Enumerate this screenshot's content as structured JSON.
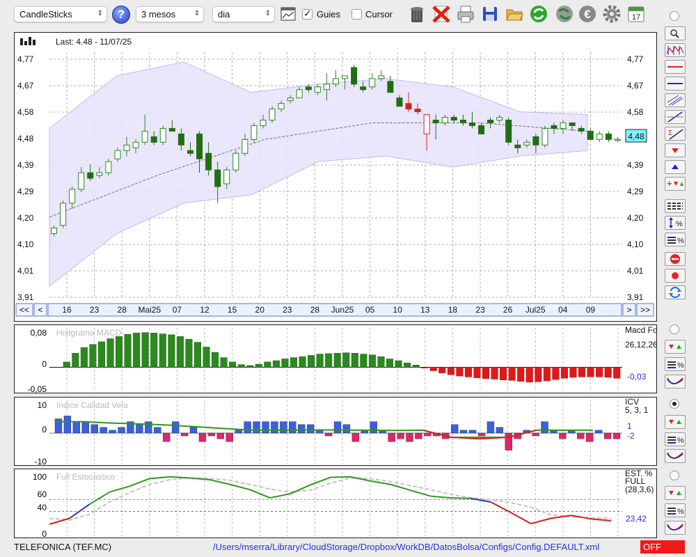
{
  "toolbar": {
    "chart_type": "CandleSticks",
    "period": "3 mesos",
    "interval": "dia",
    "guides_label": "Guies",
    "guides_checked": true,
    "cursor_label": "Cursor",
    "cursor_checked": false,
    "icons": [
      "help-icon",
      "chart-window-icon",
      "trash-icon",
      "delete-icon",
      "printer-icon",
      "save-icon",
      "open-folder-icon",
      "refresh-icon",
      "globe-refresh-icon",
      "euro-icon",
      "gear-icon",
      "calendar-icon"
    ],
    "calendar_day": "17"
  },
  "main_chart": {
    "last_label": "Last: 4.48 - 11/07/25",
    "current_value": "4,48",
    "y_ticks": [
      "4,77",
      "4,67",
      "4,58",
      "4,48",
      "4,39",
      "4,29",
      "4,20",
      "4,10",
      "4,01",
      "3,91"
    ],
    "x_labels": [
      "16",
      "23",
      "28",
      "Mai25",
      "07",
      "12",
      "15",
      "20",
      "23",
      "28",
      "Jun25",
      "05",
      "10",
      "13",
      "18",
      "23",
      "26",
      "Jul25",
      "04",
      "09"
    ],
    "nav_first": "<<",
    "nav_prev": "<",
    "nav_next": ">",
    "nav_last": ">>"
  },
  "macd_panel": {
    "title": "Histgrama MACD",
    "legend_name": "Macd Forest",
    "legend_params": "26,12,26",
    "value": "-0,03",
    "y_ticks": [
      "0,08",
      "0",
      "-0,05"
    ]
  },
  "icv_panel": {
    "title": "Indice Calidad Vela",
    "legend_name": "ICV",
    "legend_params": "5, 3, 1",
    "value_a": "1",
    "value_b": "-2",
    "y_ticks": [
      "10",
      "0",
      "-10"
    ]
  },
  "stoch_panel": {
    "title": "Full Estocastico",
    "legend_name": "EST. % FULL",
    "legend_params": "(28,3,6)",
    "value": "23,42",
    "y_ticks": [
      "100",
      "60",
      "40",
      "0"
    ]
  },
  "status": {
    "ticker": "TELEFONICA (TEF.MC)",
    "config_path": "/Users/mserra/Library/CloudStorage/Dropbox/WorkDB/DatosBolsa/Configs/Config.DEFAULT.xml",
    "state": "OFF"
  },
  "colors": {
    "up": "#2b8a1e",
    "down": "#1f6e12",
    "neg": "#e02020",
    "blue": "#3a5fe0",
    "pink": "#e0256a",
    "band_fill": "#e7e2fb",
    "band_line": "#b9b0ee"
  },
  "chart_data": [
    {
      "type": "candlestick",
      "title": "Last: 4.48 - 11/07/25",
      "ylim": [
        3.91,
        4.77
      ],
      "x_axis_labels": [
        "16",
        "23",
        "28",
        "Mai25",
        "07",
        "12",
        "15",
        "20",
        "23",
        "28",
        "Jun25",
        "05",
        "10",
        "13",
        "18",
        "23",
        "26",
        "Jul25",
        "04",
        "09"
      ],
      "ohlc": [
        [
          4.14,
          4.17,
          4.13,
          4.16
        ],
        [
          4.17,
          4.26,
          4.16,
          4.25
        ],
        [
          4.25,
          4.31,
          4.23,
          4.3
        ],
        [
          4.3,
          4.38,
          4.29,
          4.36
        ],
        [
          4.36,
          4.39,
          4.33,
          4.34
        ],
        [
          4.35,
          4.38,
          4.34,
          4.36
        ],
        [
          4.36,
          4.41,
          4.35,
          4.4
        ],
        [
          4.41,
          4.45,
          4.4,
          4.44
        ],
        [
          4.44,
          4.49,
          4.42,
          4.46
        ],
        [
          4.45,
          4.48,
          4.43,
          4.47
        ],
        [
          4.47,
          4.57,
          4.46,
          4.51
        ],
        [
          4.49,
          4.51,
          4.46,
          4.47
        ],
        [
          4.47,
          4.53,
          4.46,
          4.52
        ],
        [
          4.52,
          4.55,
          4.51,
          4.51
        ],
        [
          4.5,
          4.52,
          4.44,
          4.46
        ],
        [
          4.44,
          4.47,
          4.42,
          4.43
        ],
        [
          4.5,
          4.51,
          4.36,
          4.41
        ],
        [
          4.43,
          4.47,
          4.35,
          4.37
        ],
        [
          4.37,
          4.4,
          4.25,
          4.31
        ],
        [
          4.32,
          4.38,
          4.3,
          4.37
        ],
        [
          4.37,
          4.44,
          4.36,
          4.43
        ],
        [
          4.43,
          4.5,
          4.42,
          4.48
        ],
        [
          4.48,
          4.54,
          4.47,
          4.53
        ],
        [
          4.53,
          4.57,
          4.52,
          4.55
        ],
        [
          4.55,
          4.6,
          4.54,
          4.59
        ],
        [
          4.59,
          4.62,
          4.58,
          4.61
        ],
        [
          4.62,
          4.64,
          4.61,
          4.63
        ],
        [
          4.63,
          4.67,
          4.63,
          4.66
        ],
        [
          4.67,
          4.68,
          4.65,
          4.66
        ],
        [
          4.65,
          4.68,
          4.64,
          4.67
        ],
        [
          4.66,
          4.72,
          4.62,
          4.68
        ],
        [
          4.68,
          4.73,
          4.67,
          4.7
        ],
        [
          4.7,
          4.71,
          4.66,
          4.71
        ],
        [
          4.74,
          4.75,
          4.67,
          4.68
        ],
        [
          4.67,
          4.69,
          4.65,
          4.66
        ],
        [
          4.67,
          4.72,
          4.66,
          4.7
        ],
        [
          4.7,
          4.73,
          4.69,
          4.71
        ],
        [
          4.69,
          4.71,
          4.66,
          4.65
        ],
        [
          4.63,
          4.64,
          4.61,
          4.6
        ],
        [
          4.61,
          4.65,
          4.58,
          4.59
        ],
        [
          4.59,
          4.61,
          4.57,
          4.58
        ],
        [
          4.5,
          4.57,
          4.44,
          4.57
        ],
        [
          4.55,
          4.57,
          4.48,
          4.54
        ],
        [
          4.54,
          4.57,
          4.53,
          4.56
        ],
        [
          4.56,
          4.57,
          4.54,
          4.55
        ],
        [
          4.55,
          4.57,
          4.53,
          4.54
        ],
        [
          4.54,
          4.58,
          4.52,
          4.53
        ],
        [
          4.53,
          4.54,
          4.5,
          4.5
        ],
        [
          4.55,
          4.56,
          4.52,
          4.54
        ],
        [
          4.55,
          4.57,
          4.54,
          4.56
        ],
        [
          4.55,
          4.56,
          4.46,
          4.47
        ],
        [
          4.46,
          4.48,
          4.43,
          4.45
        ],
        [
          4.46,
          4.48,
          4.45,
          4.47
        ],
        [
          4.49,
          4.5,
          4.43,
          4.46
        ],
        [
          4.46,
          4.53,
          4.45,
          4.52
        ],
        [
          4.53,
          4.54,
          4.5,
          4.52
        ],
        [
          4.52,
          4.55,
          4.5,
          4.54
        ],
        [
          4.54,
          4.54,
          4.51,
          4.53
        ],
        [
          4.52,
          4.53,
          4.5,
          4.51
        ],
        [
          4.51,
          4.52,
          4.48,
          4.48
        ],
        [
          4.48,
          4.51,
          4.47,
          4.5
        ],
        [
          4.5,
          4.51,
          4.47,
          4.48
        ],
        [
          4.48,
          4.49,
          4.47,
          4.48
        ]
      ],
      "ma_values": [
        4.2,
        4.35,
        4.48,
        4.54,
        4.54,
        4.51
      ],
      "band_upper": [
        4.52,
        4.71,
        4.76,
        4.65,
        4.68,
        4.7,
        4.67,
        4.58,
        4.57
      ],
      "band_lower": [
        3.95,
        4.14,
        4.25,
        4.28,
        4.4,
        4.42,
        4.38,
        4.42,
        4.44
      ]
    },
    {
      "type": "bar",
      "title": "Histgrama MACD",
      "ylim": [
        -0.05,
        0.08
      ],
      "values": [
        0.012,
        0.032,
        0.045,
        0.052,
        0.058,
        0.065,
        0.07,
        0.075,
        0.078,
        0.079,
        0.078,
        0.076,
        0.074,
        0.07,
        0.064,
        0.057,
        0.046,
        0.034,
        0.022,
        0.012,
        0.006,
        0.004,
        0.007,
        0.012,
        0.015,
        0.019,
        0.022,
        0.024,
        0.027,
        0.03,
        0.031,
        0.032,
        0.033,
        0.032,
        0.03,
        0.028,
        0.024,
        0.019,
        0.015,
        0.01,
        0.005,
        -0.002,
        -0.008,
        -0.013,
        -0.017,
        -0.02,
        -0.022,
        -0.024,
        -0.026,
        -0.027,
        -0.029,
        -0.03,
        -0.032,
        -0.034,
        -0.033,
        -0.031,
        -0.028,
        -0.025,
        -0.023,
        -0.022,
        -0.022,
        -0.022,
        -0.023,
        -0.025
      ]
    },
    {
      "type": "bar",
      "title": "Indice Calidad Vela",
      "ylim": [
        -10,
        10
      ],
      "values": [
        5,
        6,
        4,
        4,
        3,
        2,
        1,
        2,
        4,
        3,
        4,
        2,
        -3,
        4,
        -1,
        2,
        -3,
        -1,
        -2,
        -3,
        1,
        4,
        4,
        4,
        4,
        4,
        4,
        3,
        3,
        1,
        -1,
        4,
        3,
        -3,
        1,
        4,
        1,
        -3,
        -2,
        -3,
        -2,
        -1,
        -1,
        -2,
        3,
        1,
        1,
        -1,
        4,
        2,
        -6,
        -2,
        1,
        -1,
        4,
        1,
        -2,
        1,
        -2,
        -3,
        1,
        -2,
        -2
      ],
      "line_values": [
        4,
        4,
        3.5,
        3.2,
        2.8,
        2.2,
        1.6,
        1.0,
        1.0,
        1.1,
        1.1,
        1.0,
        0.9,
        1.0,
        -1.5,
        -2.0,
        -1.5,
        1.0,
        1.0,
        1.0
      ]
    },
    {
      "type": "line",
      "title": "Full Estocastico",
      "ylim": [
        0,
        100
      ],
      "series": [
        {
          "values": [
            18,
            28,
            52,
            73,
            83,
            96,
            99,
            97,
            94,
            86,
            77,
            63,
            70,
            85,
            98,
            99,
            92,
            86,
            76,
            66,
            63,
            62,
            56,
            38,
            19,
            28,
            33,
            27,
            24
          ]
        },
        {
          "values": [
            28,
            25,
            35,
            56,
            72,
            86,
            94,
            97,
            96,
            93,
            86,
            78,
            73,
            76,
            88,
            97,
            96,
            91,
            84,
            77,
            69,
            63,
            60,
            55,
            47,
            34,
            31,
            29,
            28
          ]
        }
      ]
    }
  ]
}
